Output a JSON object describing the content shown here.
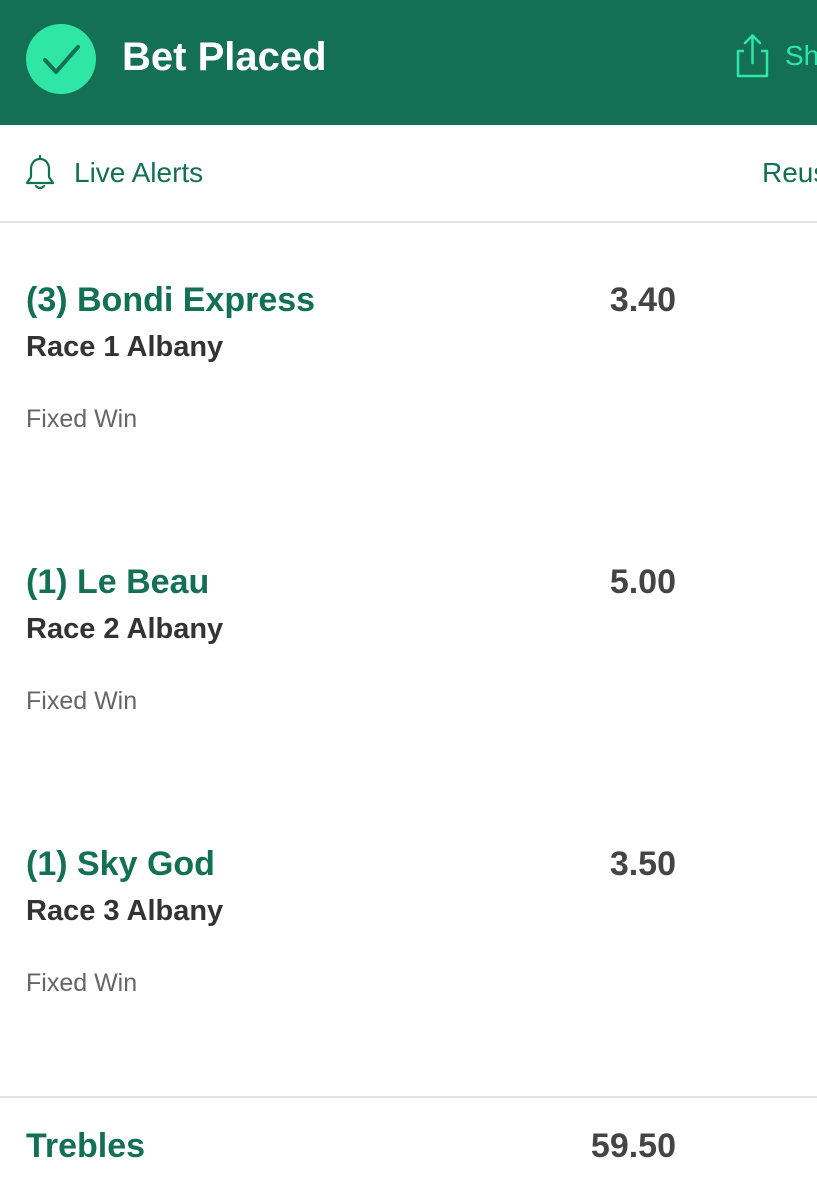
{
  "header": {
    "title": "Bet Placed",
    "status_icon": "check-circle-icon",
    "share_icon": "share-icon",
    "share_label": "Sh",
    "background_color": "#137052",
    "accent_color": "#2fe6a7"
  },
  "toolbar": {
    "alerts_icon": "bell-icon",
    "alerts_label": "Live Alerts",
    "reuse_label": "Reus"
  },
  "legs": [
    {
      "runner": "(3) Bondi Express",
      "race": "Race 1 Albany",
      "bet_type": "Fixed Win",
      "odds": "3.40"
    },
    {
      "runner": "(1) Le Beau",
      "race": "Race 2 Albany",
      "bet_type": "Fixed Win",
      "odds": "5.00"
    },
    {
      "runner": "(1) Sky God",
      "race": "Race 3 Albany",
      "bet_type": "Fixed Win",
      "odds": "3.50"
    }
  ],
  "summary": {
    "label": "Trebles",
    "odds": "59.50"
  }
}
